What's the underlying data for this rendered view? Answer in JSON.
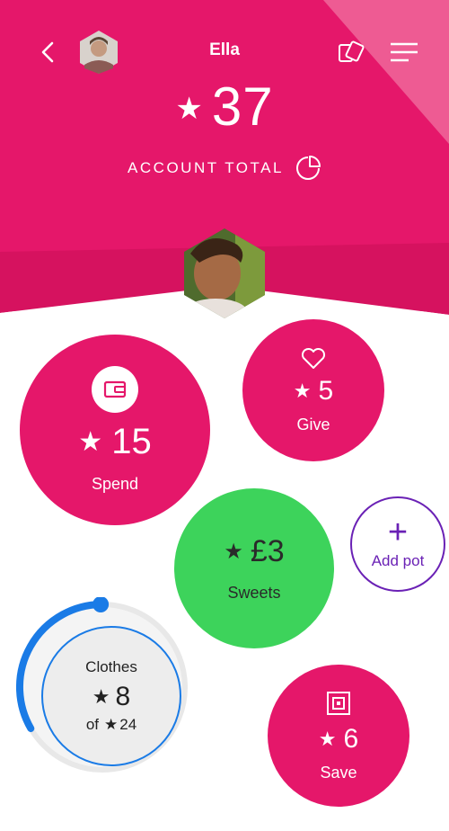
{
  "header": {
    "title": "Ella",
    "total_star": "★",
    "total_value": "37",
    "account_label": "ACCOUNT TOTAL"
  },
  "icons": {
    "back": "back-arrow-icon",
    "parent_avatar": "parent-avatar",
    "cards": "cards-icon",
    "menu": "menu-icon",
    "pie": "pie-chart-icon",
    "child_avatar": "child-avatar"
  },
  "pots": {
    "spend": {
      "label": "Spend",
      "star": "★",
      "value": "15",
      "icon": "wallet-icon"
    },
    "give": {
      "label": "Give",
      "star": "★",
      "value": "5",
      "icon": "heart-icon"
    },
    "sweets": {
      "label": "Sweets",
      "star": "★",
      "value": "£3"
    },
    "add": {
      "label": "Add pot",
      "plus": "+"
    },
    "clothes": {
      "label": "Clothes",
      "star": "★",
      "value": "8",
      "of_label": "of",
      "target": "24",
      "progress": 0.33
    },
    "save": {
      "label": "Save",
      "star": "★",
      "value": "6",
      "icon": "safe-icon"
    }
  },
  "colors": {
    "primary_pink": "#e5176a",
    "green": "#3dd35b",
    "purple": "#6a21b5",
    "progress_blue": "#1a7be6"
  }
}
